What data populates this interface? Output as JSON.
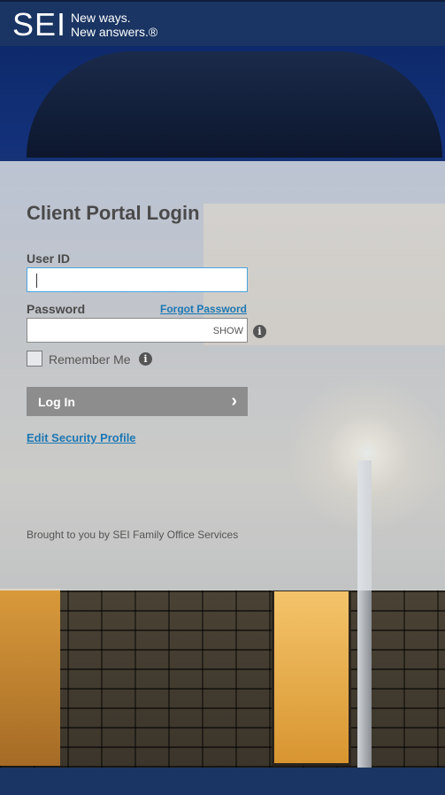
{
  "header": {
    "logo": "SEI",
    "tagline_line1": "New ways.",
    "tagline_line2": "New answers.®"
  },
  "login": {
    "title": "Client Portal Login",
    "userid_label": "User ID",
    "userid_value": "",
    "password_label": "Password",
    "forgot_link": "Forgot Password",
    "password_value": "",
    "show_toggle": "SHOW",
    "remember_label": "Remember Me",
    "remember_checked": false,
    "login_button": "Log In",
    "edit_security_link": "Edit Security Profile",
    "footer": "Brought to you by SEI Family Office Services"
  },
  "icons": {
    "info": "info-icon",
    "chevron": "chevron-right-icon"
  },
  "colors": {
    "brand_blue": "#1a3563",
    "link_blue": "#1c77b3",
    "button_gray": "#8d8d8d"
  }
}
